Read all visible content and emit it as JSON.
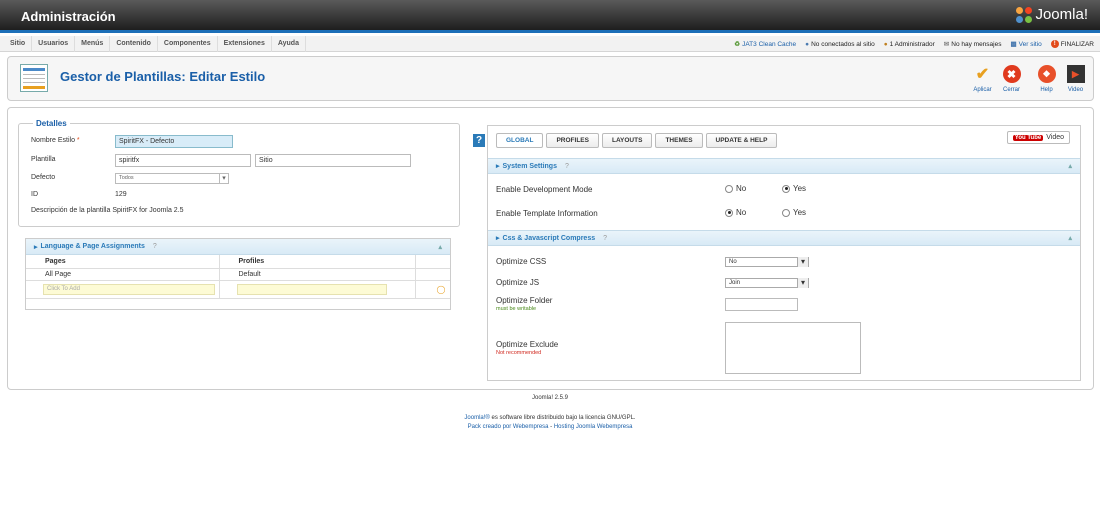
{
  "header": {
    "title": "Administración",
    "logo_text": "Joomla!"
  },
  "menu": [
    "Sitio",
    "Usuarios",
    "Menús",
    "Contenido",
    "Componentes",
    "Extensiones",
    "Ayuda"
  ],
  "status": {
    "clean_cache": "JAT3 Clean Cache",
    "site_visitors": "No conectados al sitio",
    "admins": "1 Administrador",
    "messages": "No hay mensajes",
    "view_site": "Ver sitio",
    "logout": "FINALIZAR"
  },
  "toolbar": {
    "page_title": "Gestor de Plantillas: Editar Estilo",
    "apply": "Aplicar",
    "close": "Cerrar",
    "help": "Help",
    "video": "Video"
  },
  "details": {
    "legend": "Detalles",
    "style_name_label": "Nombre Estilo",
    "required_mark": "*",
    "style_name_value": "SpiritFX - Defecto",
    "template_label": "Plantilla",
    "template_value": "spiritfx",
    "template_client": "Sitio",
    "default_label": "Defecto",
    "default_value": "Todos",
    "id_label": "ID",
    "id_value": "129",
    "description_label": "Descripción de la plantilla",
    "description_value": "SpiritFX for Joomla 2.5"
  },
  "assignments": {
    "title": "Language & Page Assignments",
    "help": "?",
    "col_pages": "Pages",
    "col_profiles": "Profiles",
    "row_page": "All Page",
    "row_profile": "Default",
    "add_placeholder": "Click To Add"
  },
  "tabs": [
    "GLOBAL",
    "PROFILES",
    "LAYOUTS",
    "THEMES",
    "UPDATE & HELP"
  ],
  "youtube": {
    "logo": "You Tube",
    "label": "Video"
  },
  "system_settings": {
    "title": "System Settings",
    "help": "?",
    "dev_mode_label": "Enable Development Mode",
    "info_label": "Enable Template Information",
    "no": "No",
    "yes": "Yes"
  },
  "compress": {
    "title": "Css & Javascript Compress",
    "help": "?",
    "css_label": "Optimize CSS",
    "css_value": "No",
    "js_label": "Optimize JS",
    "js_value": "Join",
    "folder_label": "Optimize Folder",
    "folder_note": "must be writable",
    "exclude_label": "Optimize Exclude",
    "exclude_note": "Not recommended"
  },
  "footer": {
    "version": "Joomla! 2.5.9",
    "license_link": "Joomla!®",
    "license_text": " es software libre distribuido bajo la licencia GNU/GPL.",
    "pack_link": "Pack creado por Webempresa",
    "sep": " - ",
    "hosting_link": "Hosting Joomla Webempresa"
  },
  "colors": {
    "accent": "#1a5fa8",
    "header_bar": "#1c6fb8"
  }
}
